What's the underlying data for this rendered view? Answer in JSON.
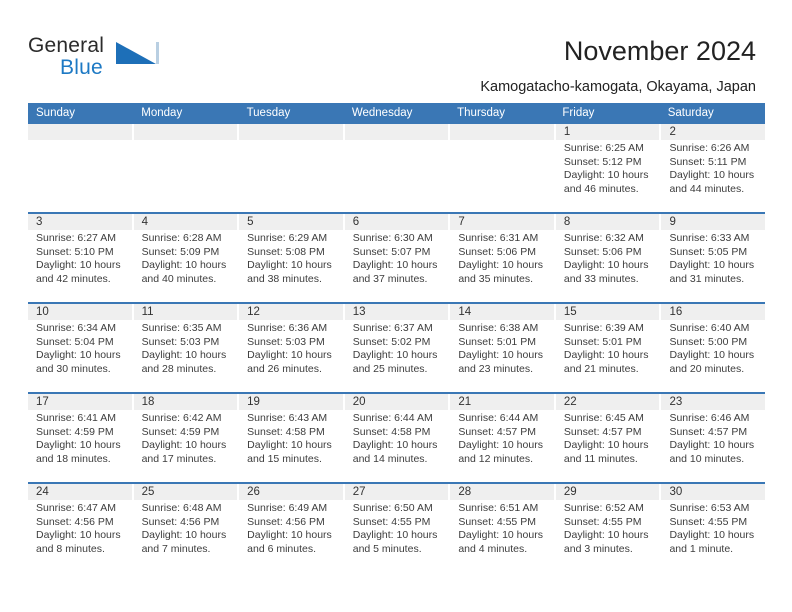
{
  "brand": {
    "name_part1": "General",
    "name_part2": "Blue",
    "logo_icon": "triangle-logo-icon"
  },
  "header": {
    "title": "November 2024",
    "location": "Kamogatacho-kamogata, Okayama, Japan"
  },
  "colors": {
    "header_blue": "#3a77b5",
    "brand_blue": "#1d79c4",
    "daynum_band": "#efefef"
  },
  "weekday_headers": [
    "Sunday",
    "Monday",
    "Tuesday",
    "Wednesday",
    "Thursday",
    "Friday",
    "Saturday"
  ],
  "weeks": [
    [
      {
        "day": "",
        "empty": true
      },
      {
        "day": "",
        "empty": true
      },
      {
        "day": "",
        "empty": true
      },
      {
        "day": "",
        "empty": true
      },
      {
        "day": "",
        "empty": true
      },
      {
        "day": "1",
        "sunrise": "Sunrise: 6:25 AM",
        "sunset": "Sunset: 5:12 PM",
        "daylight": "Daylight: 10 hours and 46 minutes."
      },
      {
        "day": "2",
        "sunrise": "Sunrise: 6:26 AM",
        "sunset": "Sunset: 5:11 PM",
        "daylight": "Daylight: 10 hours and 44 minutes."
      }
    ],
    [
      {
        "day": "3",
        "sunrise": "Sunrise: 6:27 AM",
        "sunset": "Sunset: 5:10 PM",
        "daylight": "Daylight: 10 hours and 42 minutes."
      },
      {
        "day": "4",
        "sunrise": "Sunrise: 6:28 AM",
        "sunset": "Sunset: 5:09 PM",
        "daylight": "Daylight: 10 hours and 40 minutes."
      },
      {
        "day": "5",
        "sunrise": "Sunrise: 6:29 AM",
        "sunset": "Sunset: 5:08 PM",
        "daylight": "Daylight: 10 hours and 38 minutes."
      },
      {
        "day": "6",
        "sunrise": "Sunrise: 6:30 AM",
        "sunset": "Sunset: 5:07 PM",
        "daylight": "Daylight: 10 hours and 37 minutes."
      },
      {
        "day": "7",
        "sunrise": "Sunrise: 6:31 AM",
        "sunset": "Sunset: 5:06 PM",
        "daylight": "Daylight: 10 hours and 35 minutes."
      },
      {
        "day": "8",
        "sunrise": "Sunrise: 6:32 AM",
        "sunset": "Sunset: 5:06 PM",
        "daylight": "Daylight: 10 hours and 33 minutes."
      },
      {
        "day": "9",
        "sunrise": "Sunrise: 6:33 AM",
        "sunset": "Sunset: 5:05 PM",
        "daylight": "Daylight: 10 hours and 31 minutes."
      }
    ],
    [
      {
        "day": "10",
        "sunrise": "Sunrise: 6:34 AM",
        "sunset": "Sunset: 5:04 PM",
        "daylight": "Daylight: 10 hours and 30 minutes."
      },
      {
        "day": "11",
        "sunrise": "Sunrise: 6:35 AM",
        "sunset": "Sunset: 5:03 PM",
        "daylight": "Daylight: 10 hours and 28 minutes."
      },
      {
        "day": "12",
        "sunrise": "Sunrise: 6:36 AM",
        "sunset": "Sunset: 5:03 PM",
        "daylight": "Daylight: 10 hours and 26 minutes."
      },
      {
        "day": "13",
        "sunrise": "Sunrise: 6:37 AM",
        "sunset": "Sunset: 5:02 PM",
        "daylight": "Daylight: 10 hours and 25 minutes."
      },
      {
        "day": "14",
        "sunrise": "Sunrise: 6:38 AM",
        "sunset": "Sunset: 5:01 PM",
        "daylight": "Daylight: 10 hours and 23 minutes."
      },
      {
        "day": "15",
        "sunrise": "Sunrise: 6:39 AM",
        "sunset": "Sunset: 5:01 PM",
        "daylight": "Daylight: 10 hours and 21 minutes."
      },
      {
        "day": "16",
        "sunrise": "Sunrise: 6:40 AM",
        "sunset": "Sunset: 5:00 PM",
        "daylight": "Daylight: 10 hours and 20 minutes."
      }
    ],
    [
      {
        "day": "17",
        "sunrise": "Sunrise: 6:41 AM",
        "sunset": "Sunset: 4:59 PM",
        "daylight": "Daylight: 10 hours and 18 minutes."
      },
      {
        "day": "18",
        "sunrise": "Sunrise: 6:42 AM",
        "sunset": "Sunset: 4:59 PM",
        "daylight": "Daylight: 10 hours and 17 minutes."
      },
      {
        "day": "19",
        "sunrise": "Sunrise: 6:43 AM",
        "sunset": "Sunset: 4:58 PM",
        "daylight": "Daylight: 10 hours and 15 minutes."
      },
      {
        "day": "20",
        "sunrise": "Sunrise: 6:44 AM",
        "sunset": "Sunset: 4:58 PM",
        "daylight": "Daylight: 10 hours and 14 minutes."
      },
      {
        "day": "21",
        "sunrise": "Sunrise: 6:44 AM",
        "sunset": "Sunset: 4:57 PM",
        "daylight": "Daylight: 10 hours and 12 minutes."
      },
      {
        "day": "22",
        "sunrise": "Sunrise: 6:45 AM",
        "sunset": "Sunset: 4:57 PM",
        "daylight": "Daylight: 10 hours and 11 minutes."
      },
      {
        "day": "23",
        "sunrise": "Sunrise: 6:46 AM",
        "sunset": "Sunset: 4:57 PM",
        "daylight": "Daylight: 10 hours and 10 minutes."
      }
    ],
    [
      {
        "day": "24",
        "sunrise": "Sunrise: 6:47 AM",
        "sunset": "Sunset: 4:56 PM",
        "daylight": "Daylight: 10 hours and 8 minutes."
      },
      {
        "day": "25",
        "sunrise": "Sunrise: 6:48 AM",
        "sunset": "Sunset: 4:56 PM",
        "daylight": "Daylight: 10 hours and 7 minutes."
      },
      {
        "day": "26",
        "sunrise": "Sunrise: 6:49 AM",
        "sunset": "Sunset: 4:56 PM",
        "daylight": "Daylight: 10 hours and 6 minutes."
      },
      {
        "day": "27",
        "sunrise": "Sunrise: 6:50 AM",
        "sunset": "Sunset: 4:55 PM",
        "daylight": "Daylight: 10 hours and 5 minutes."
      },
      {
        "day": "28",
        "sunrise": "Sunrise: 6:51 AM",
        "sunset": "Sunset: 4:55 PM",
        "daylight": "Daylight: 10 hours and 4 minutes."
      },
      {
        "day": "29",
        "sunrise": "Sunrise: 6:52 AM",
        "sunset": "Sunset: 4:55 PM",
        "daylight": "Daylight: 10 hours and 3 minutes."
      },
      {
        "day": "30",
        "sunrise": "Sunrise: 6:53 AM",
        "sunset": "Sunset: 4:55 PM",
        "daylight": "Daylight: 10 hours and 1 minute."
      }
    ]
  ]
}
